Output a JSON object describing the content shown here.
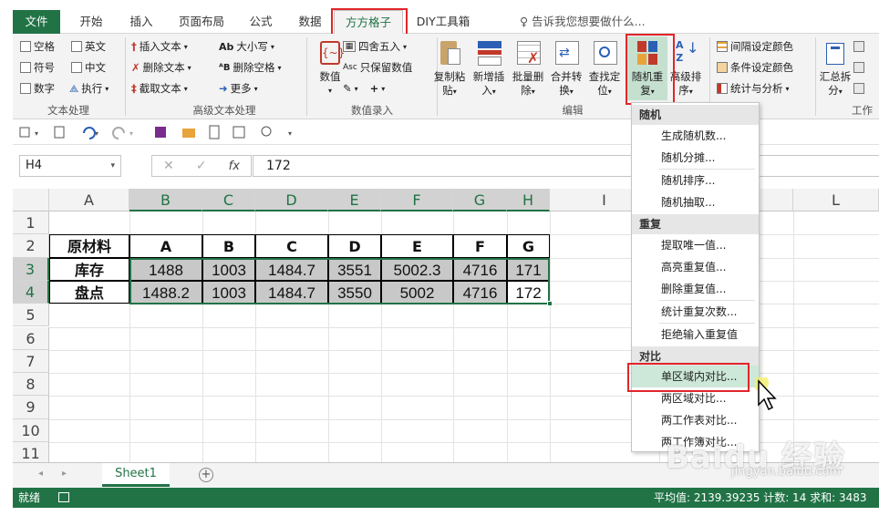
{
  "tabs": [
    {
      "label": "文件"
    },
    {
      "label": "开始"
    },
    {
      "label": "插入"
    },
    {
      "label": "页面布局"
    },
    {
      "label": "公式"
    },
    {
      "label": "数据"
    },
    {
      "label": "方方格子"
    },
    {
      "label": "DIY工具箱"
    }
  ],
  "tell_me": "告诉我您想要做什么...",
  "ribbon": {
    "text_group": {
      "items": [
        "空格",
        "英文",
        "符号",
        "中文",
        "数字",
        "执行"
      ],
      "label": "文本处理"
    },
    "adv_text_group": {
      "items": [
        "插入文本",
        "删除文本",
        "截取文本",
        "大小写",
        "删除空格",
        "更多"
      ],
      "label": "高级文本处理"
    },
    "num_group": {
      "items": [
        "数值",
        "四舍五入",
        "只保留数值"
      ],
      "label": "数值录入"
    },
    "edit_group": {
      "buttons": [
        {
          "line1": "复制粘",
          "line2": "贴"
        },
        {
          "line1": "新增插",
          "line2": "入"
        },
        {
          "line1": "批量删",
          "line2": "除"
        },
        {
          "line1": "合并转",
          "line2": "换"
        },
        {
          "line1": "查找定",
          "line2": "位"
        },
        {
          "line1": "随机重",
          "line2": "复"
        },
        {
          "line1": "高级排",
          "line2": "序"
        }
      ],
      "label": "编辑"
    },
    "color_group": {
      "items": [
        "间隔设定颜色",
        "条件设定颜色",
        "统计与分析"
      ]
    },
    "right_group": {
      "button_line1": "汇总拆",
      "button_line2": "分",
      "label": "工作"
    }
  },
  "formula_bar": {
    "name_box": "H4",
    "value": "172"
  },
  "grid": {
    "columns": [
      "A",
      "B",
      "C",
      "D",
      "E",
      "F",
      "G",
      "H",
      "I",
      "L"
    ],
    "rows": [
      "1",
      "2",
      "3",
      "4",
      "5",
      "6",
      "7",
      "8",
      "9",
      "10",
      "11"
    ],
    "header_row": [
      "原材料",
      "A",
      "B",
      "C",
      "D",
      "E",
      "F",
      "G"
    ],
    "row3": [
      "库存",
      "1488",
      "1003",
      "1484.7",
      "3551",
      "5002.3",
      "4716",
      "171"
    ],
    "row4": [
      "盘点",
      "1488.2",
      "1003",
      "1484.7",
      "3550",
      "5002",
      "4716",
      "172"
    ]
  },
  "sheet_tab": "Sheet1",
  "status": {
    "ready": "就绪",
    "right": "平均值: 2139.39235  计数: 14  求和: 3483"
  },
  "menu": {
    "sections": [
      {
        "title": "随机",
        "items": [
          "生成随机数...",
          "随机分摊...",
          "随机排序...",
          "随机抽取..."
        ]
      },
      {
        "title": "重复",
        "items": [
          "提取唯一值...",
          "高亮重复值...",
          "删除重复值...",
          "统计重复次数...",
          "拒绝输入重复值"
        ]
      },
      {
        "title": "对比",
        "items": [
          "单区域内对比...",
          "两区域对比...",
          "两工作表对比...",
          "两工作簿对比..."
        ]
      }
    ]
  },
  "watermark": "Baidu 经验 jingyan.baidu.com",
  "colors": {
    "excel_green": "#217346",
    "highlight_red": "#e0262b",
    "selection_gray": "#c8c8c8"
  }
}
